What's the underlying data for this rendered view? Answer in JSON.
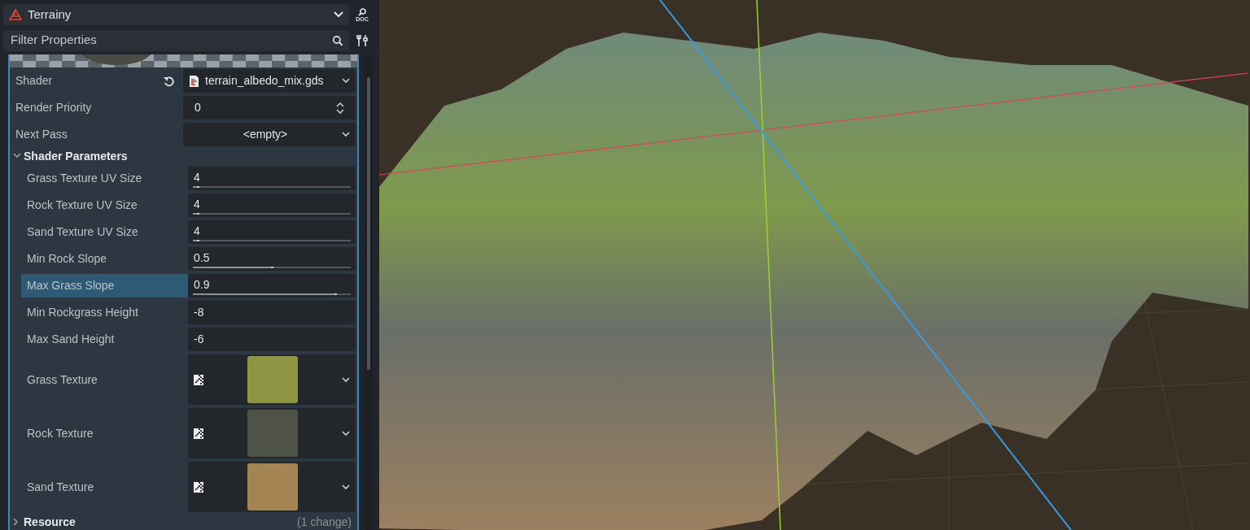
{
  "object_selector": {
    "label": "Terrainy",
    "doc_label": "DOC"
  },
  "filter": {
    "placeholder": "Filter Properties"
  },
  "material_properties": [
    {
      "kind": "resource",
      "label": "Shader",
      "value": "terrain_albedo_mix.gds",
      "revertable": true
    },
    {
      "kind": "spin",
      "label": "Render Priority",
      "value": "0",
      "revertable": false
    },
    {
      "kind": "resource_empty",
      "label": "Next Pass",
      "value": "<empty>",
      "revertable": false
    }
  ],
  "section": {
    "label": "Shader Parameters",
    "expanded": true
  },
  "parameters": [
    {
      "kind": "slider",
      "label": "Grass Texture UV Size",
      "value": "4",
      "level": 0.04,
      "selected": false
    },
    {
      "kind": "slider",
      "label": "Rock Texture UV Size",
      "value": "4",
      "level": 0.04,
      "selected": false
    },
    {
      "kind": "slider",
      "label": "Sand Texture UV Size",
      "value": "4",
      "level": 0.04,
      "selected": false
    },
    {
      "kind": "slider",
      "label": "Min Rock Slope",
      "value": "0.5",
      "level": 0.51,
      "selected": false
    },
    {
      "kind": "slider",
      "label": "Max Grass Slope",
      "value": "0.9",
      "level": 0.91,
      "selected": true
    },
    {
      "kind": "number",
      "label": "Min Rockgrass Height",
      "value": "-8",
      "selected": false
    },
    {
      "kind": "number",
      "label": "Max Sand Height",
      "value": "-6",
      "selected": false
    },
    {
      "kind": "texture",
      "label": "Grass Texture",
      "color": "#8e9643",
      "selected": false
    },
    {
      "kind": "texture",
      "label": "Rock Texture",
      "color": "#4f5246",
      "selected": false
    },
    {
      "kind": "texture",
      "label": "Sand Texture",
      "color": "#a48552",
      "selected": false
    }
  ],
  "footer": {
    "label": "Resource",
    "note": "(1 change)",
    "expanded": false
  }
}
